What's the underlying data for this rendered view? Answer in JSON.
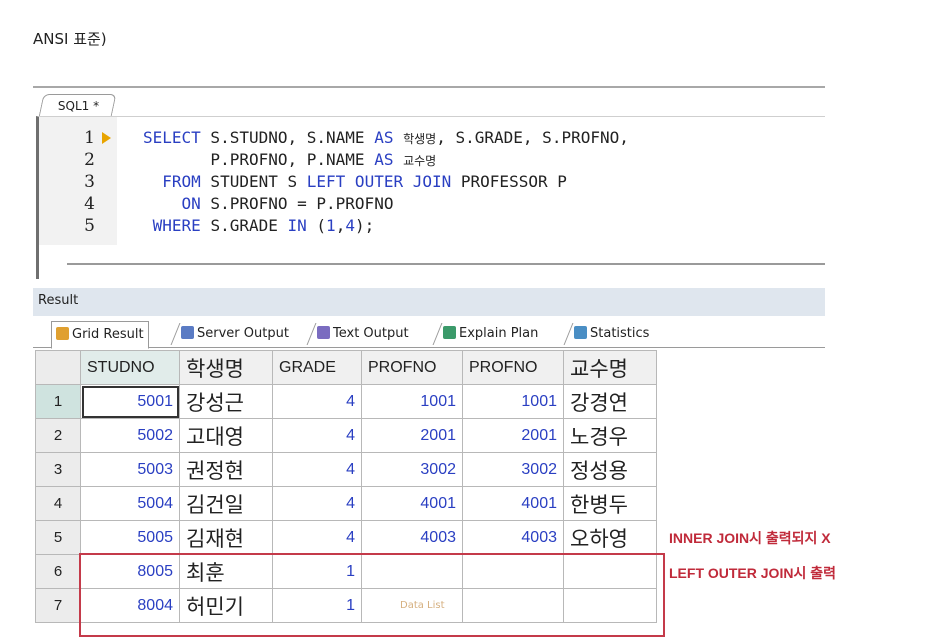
{
  "heading": "ANSI 표준)",
  "editor": {
    "tab_label": "SQL1 *",
    "lines": [
      {
        "no": "1",
        "parts": [
          [
            "kw",
            "SELECT"
          ],
          [
            "tx",
            " S.STUDNO, S.NAME "
          ],
          [
            "kw",
            "AS"
          ],
          [
            "tx",
            " "
          ],
          [
            "ko",
            "학생명"
          ],
          [
            "tx",
            ", S.GRADE, S.PROFNO,"
          ]
        ]
      },
      {
        "no": "2",
        "parts": [
          [
            "tx",
            "       P.PROFNO, P.NAME "
          ],
          [
            "kw",
            "AS"
          ],
          [
            "tx",
            " "
          ],
          [
            "ko",
            "교수명"
          ]
        ]
      },
      {
        "no": "3",
        "parts": [
          [
            "tx",
            "  "
          ],
          [
            "kw",
            "FROM"
          ],
          [
            "tx",
            " STUDENT S "
          ],
          [
            "kw",
            "LEFT OUTER JOIN"
          ],
          [
            "tx",
            " PROFESSOR P"
          ]
        ]
      },
      {
        "no": "4",
        "parts": [
          [
            "tx",
            "    "
          ],
          [
            "kw",
            "ON"
          ],
          [
            "tx",
            " S.PROFNO = P.PROFNO"
          ]
        ]
      },
      {
        "no": "5",
        "parts": [
          [
            "tx",
            " "
          ],
          [
            "kw",
            "WHERE"
          ],
          [
            "tx",
            " S.GRADE "
          ],
          [
            "kw",
            "IN"
          ],
          [
            "tx",
            " ("
          ],
          [
            "num",
            "1"
          ],
          [
            "tx",
            ","
          ],
          [
            "num",
            "4"
          ],
          [
            "tx",
            ");"
          ]
        ]
      }
    ]
  },
  "result": {
    "label": "Result",
    "tabs": [
      {
        "label": "Grid Result",
        "icon": "grid-icon",
        "color": "#e0a030"
      },
      {
        "label": "Server Output",
        "icon": "server-icon",
        "color": "#5a7bc4"
      },
      {
        "label": "Text Output",
        "icon": "text-icon",
        "color": "#7a6cc0"
      },
      {
        "label": "Explain Plan",
        "icon": "plan-icon",
        "color": "#3b9a6a"
      },
      {
        "label": "Statistics",
        "icon": "stats-icon",
        "color": "#4a8ec4"
      }
    ],
    "columns": [
      "STUDNO",
      "학생명",
      "GRADE",
      "PROFNO",
      "PROFNO",
      "교수명"
    ],
    "rows": [
      [
        "1",
        "5001",
        "강성근",
        "4",
        "1001",
        "1001",
        "강경연"
      ],
      [
        "2",
        "5002",
        "고대영",
        "4",
        "2001",
        "2001",
        "노경우"
      ],
      [
        "3",
        "5003",
        "권정현",
        "4",
        "3002",
        "3002",
        "정성용"
      ],
      [
        "4",
        "5004",
        "김건일",
        "4",
        "4001",
        "4001",
        "한병두"
      ],
      [
        "5",
        "5005",
        "김재현",
        "4",
        "4003",
        "4003",
        "오하영"
      ],
      [
        "6",
        "8005",
        "최훈",
        "1",
        "",
        "",
        ""
      ],
      [
        "7",
        "8004",
        "허민기",
        "1",
        "",
        "",
        ""
      ]
    ]
  },
  "annotations": {
    "note1": "INNER JOIN시 출력되지 X",
    "note2": "LEFT OUTER JOIN시 출력",
    "color": "#c02a3a"
  },
  "watermark": "Data List"
}
